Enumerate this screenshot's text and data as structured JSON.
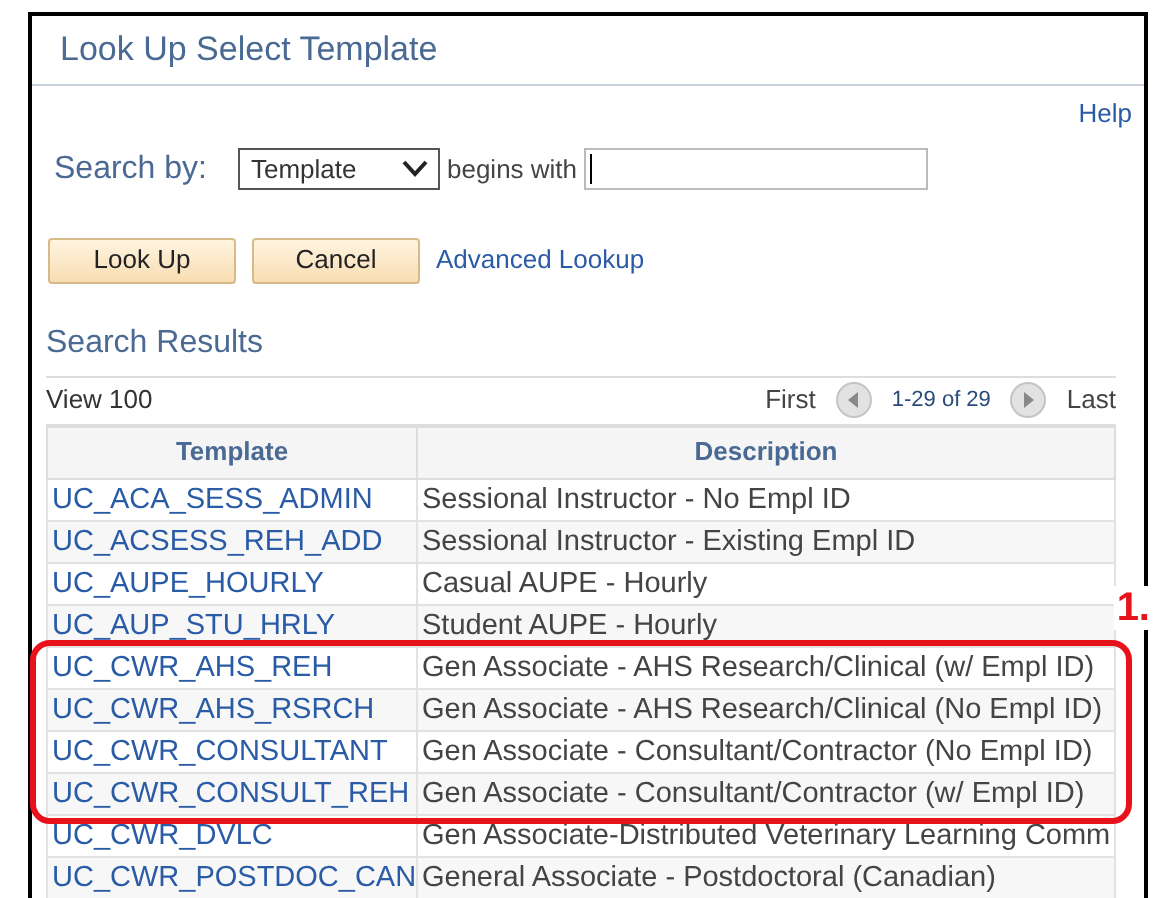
{
  "window": {
    "title": "Look Up Select Template"
  },
  "help_link": "Help",
  "search": {
    "label": "Search by:",
    "field": "Template",
    "operator": "begins with"
  },
  "buttons": [
    "Look Up",
    "Cancel"
  ],
  "advanced_link": "Advanced Lookup",
  "results": {
    "title": "Search Results",
    "view_link": "View 100",
    "first": "First",
    "range": "1-29 of 29",
    "last": "Last",
    "columns": [
      "Template",
      "Description"
    ],
    "rows": [
      {
        "template": "UC_ACA_SESS_ADMIN",
        "description": "Sessional Instructor - No Empl ID",
        "highlighted": false
      },
      {
        "template": "UC_ACSESS_REH_ADD",
        "description": "Sessional Instructor - Existing Empl ID",
        "highlighted": false
      },
      {
        "template": "UC_AUPE_HOURLY",
        "description": "Casual AUPE - Hourly",
        "highlighted": false
      },
      {
        "template": "UC_AUP_STU_HRLY",
        "description": "Student AUPE - Hourly",
        "highlighted": false
      },
      {
        "template": "UC_CWR_AHS_REH",
        "description": "Gen Associate - AHS Research/Clinical (w/ Empl ID)",
        "highlighted": true
      },
      {
        "template": "UC_CWR_AHS_RSRCH",
        "description": "Gen Associate - AHS Research/Clinical (No Empl ID)",
        "highlighted": true
      },
      {
        "template": "UC_CWR_CONSULTANT",
        "description": "Gen Associate - Consultant/Contractor (No Empl ID)",
        "highlighted": true
      },
      {
        "template": "UC_CWR_CONSULT_REH",
        "description": "Gen Associate - Consultant/Contractor (w/ Empl ID)",
        "highlighted": true
      },
      {
        "template": "UC_CWR_DVLC",
        "description": "Gen Associate-Distributed Veterinary Learning Comm",
        "highlighted": false
      },
      {
        "template": "UC_CWR_POSTDOC_CAN",
        "description": "General Associate - Postdoctoral (Canadian)",
        "highlighted": false
      }
    ]
  },
  "annotation": {
    "label": "1."
  }
}
